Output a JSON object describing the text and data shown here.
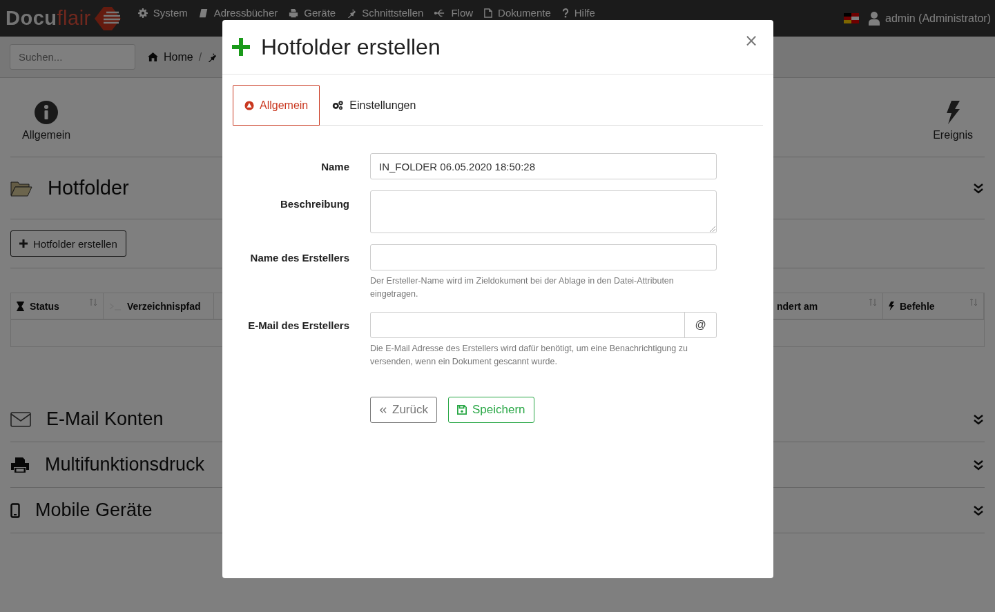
{
  "navbar": {
    "logo": {
      "part_1": "Docu",
      "part_2": "flair"
    },
    "menu": [
      {
        "label": "System"
      },
      {
        "label": "Adressbücher"
      },
      {
        "label": "Geräte"
      },
      {
        "label": "Schnittstellen"
      },
      {
        "label": "Flow"
      },
      {
        "label": "Dokumente"
      },
      {
        "label": "Hilfe"
      }
    ],
    "user": "admin (Administrator)"
  },
  "search": {
    "placeholder": "Suchen..."
  },
  "breadcrumb": [
    {
      "label": "Home",
      "separator": "/"
    }
  ],
  "toolbar": [
    {
      "label": "Allgemein"
    },
    {
      "label": "Ereignis"
    }
  ],
  "sections": [
    {
      "title": "Hotfolder",
      "create_button": "Hotfolder erstellen",
      "columns_left": [
        {
          "label": "Status",
          "sortable": true
        },
        {
          "label": "Verzeichnispfad"
        }
      ],
      "columns_right": [
        {
          "label": "ndert am",
          "sortable": true
        },
        {
          "label": "Befehle",
          "sortable": true
        }
      ]
    },
    {
      "title": "E-Mail Konten"
    },
    {
      "title": "Multifunktionsdruck"
    },
    {
      "title": "Mobile Geräte"
    }
  ],
  "modal": {
    "title": "Hotfolder erstellen",
    "close": "×",
    "tabs": [
      {
        "label": "Allgemein",
        "selected": true
      },
      {
        "label": "Einstellungen",
        "selected": false
      }
    ],
    "fields": [
      {
        "label": "Name",
        "kind": "input",
        "value": "IN_FOLDER 06.05.2020 18:50:28"
      },
      {
        "label": "Beschreibung",
        "kind": "textarea"
      },
      {
        "label": "Name des Erstellers",
        "kind": "input",
        "help": "Der Ersteller-Name wird im Zieldokument bei der Ablage in den Datei-Attributen eingetragen."
      },
      {
        "label": "E-Mail des Erstellers",
        "kind": "addon",
        "addon": "@",
        "help": "Die E-Mail Adresse des Erstellers wird dafür benötigt, um eine Benachrichtigung zu versenden, wenn ein Dokument gescannt wurde."
      }
    ],
    "buttons": [
      {
        "label": "Zurück",
        "kind": "back"
      },
      {
        "label": "Speichern",
        "kind": "save"
      }
    ]
  }
}
